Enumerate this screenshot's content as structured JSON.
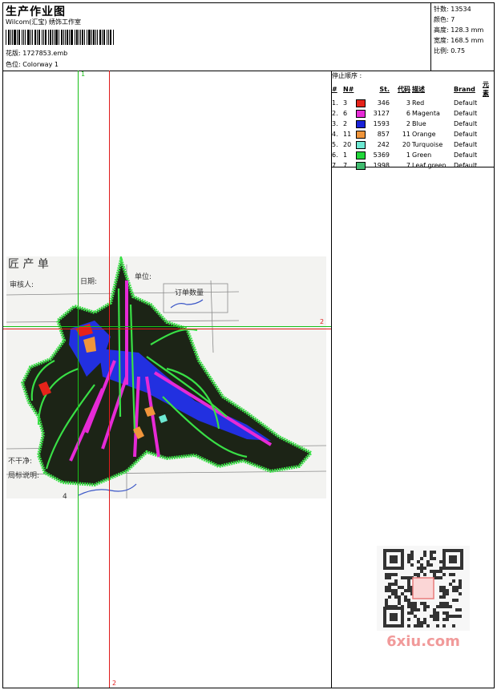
{
  "header": {
    "title": "生产作业图",
    "studio": "Wilcom(汇宝) 绣饰工作室",
    "design_label": "花版: 1727853.emb",
    "colorway_label": "色位:  Colorway 1"
  },
  "stats": {
    "stitches": "针数: 13534",
    "colors": "颜色: 7",
    "height": "高度: 128.3 mm",
    "width": "宽度: 168.5 mm",
    "scale": "比例: 0.75"
  },
  "sequence": {
    "title": "停止顺序 :",
    "headers": [
      "#",
      "N#",
      "St.",
      "代码",
      "描述",
      "Brand",
      "元素"
    ],
    "rows": [
      {
        "idx": "1.",
        "n": "3",
        "st": "346",
        "code": "3",
        "desc": "Red",
        "brand": "Default",
        "color": "#e5231a"
      },
      {
        "idx": "2.",
        "n": "6",
        "st": "3127",
        "code": "6",
        "desc": "Magenta",
        "brand": "Default",
        "color": "#e62ad6"
      },
      {
        "idx": "3.",
        "n": "2",
        "st": "1593",
        "code": "2",
        "desc": "Blue",
        "brand": "Default",
        "color": "#1a22d8"
      },
      {
        "idx": "4.",
        "n": "11",
        "st": "857",
        "code": "11",
        "desc": "Orange",
        "brand": "Default",
        "color": "#f0953b"
      },
      {
        "idx": "5.",
        "n": "20",
        "st": "242",
        "code": "20",
        "desc": "Turquoise",
        "brand": "Default",
        "color": "#6de8d2"
      },
      {
        "idx": "6.",
        "n": "1",
        "st": "5369",
        "code": "1",
        "desc": "Green",
        "brand": "Default",
        "color": "#22d63a"
      },
      {
        "idx": "7.",
        "n": "7",
        "st": "1998",
        "code": "7",
        "desc": "Leaf green",
        "brand": "Default",
        "color": "#3fba6e"
      }
    ]
  },
  "guides": {
    "v1": "1",
    "v2": "2",
    "h2": "2"
  },
  "photo_text": {
    "line1": "匠   产   单",
    "line2": "审核人:",
    "line3": "日期:",
    "line4": "单位:",
    "line5": "订单数量",
    "line6": "不干净:",
    "line7": "局标说明:",
    "line8": "4"
  },
  "watermark": {
    "text": "6xiu.com"
  },
  "colors": {
    "guide_green": "#18c018",
    "guide_red": "#e01a1a"
  }
}
